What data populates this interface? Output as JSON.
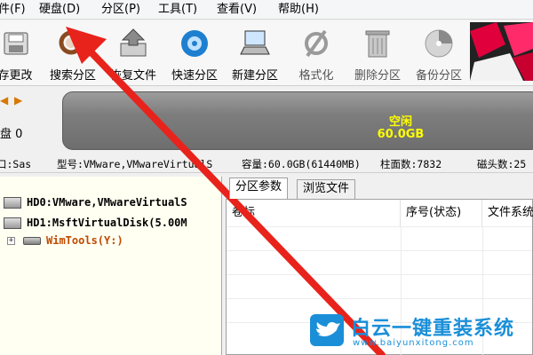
{
  "menu": {
    "items": [
      {
        "label": "件(F)"
      },
      {
        "label": "硬盘(D)"
      },
      {
        "label": "分区(P)"
      },
      {
        "label": "工具(T)"
      },
      {
        "label": "查看(V)"
      },
      {
        "label": "帮助(H)"
      }
    ]
  },
  "toolbar": {
    "items": [
      {
        "label": "存更改",
        "icon": "save-icon"
      },
      {
        "label": "搜索分区",
        "icon": "search-partition-icon"
      },
      {
        "label": "恢复文件",
        "icon": "recover-file-icon"
      },
      {
        "label": "快速分区",
        "icon": "quick-partition-icon"
      },
      {
        "label": "新建分区",
        "icon": "new-partition-icon"
      },
      {
        "label": "格式化",
        "icon": "format-icon"
      },
      {
        "label": "删除分区",
        "icon": "delete-partition-icon"
      },
      {
        "label": "备份分区",
        "icon": "backup-partition-icon"
      }
    ]
  },
  "disk": {
    "label": "盘 0",
    "free_label": "空闲",
    "free_size": "60.0GB",
    "bar_color": "#7d7d7d",
    "text_color": "#ffff00"
  },
  "info": {
    "interface": "口:Sas",
    "model": "型号:VMware,VMwareVirtualS",
    "capacity": "容量:60.0GB(61440MB)",
    "cylinders": "柱面数:7832",
    "heads": "磁头数:25"
  },
  "tree": {
    "items": [
      {
        "label": "HD0:VMware,VMwareVirtualS"
      },
      {
        "label": "HD1:MsftVirtualDisk(5.00M"
      },
      {
        "label": "WimTools(Y:)"
      }
    ]
  },
  "tabs": [
    {
      "label": "分区参数"
    },
    {
      "label": "浏览文件"
    }
  ],
  "table": {
    "columns": [
      {
        "label": "卷标"
      },
      {
        "label": "序号(状态)"
      },
      {
        "label": "文件系统"
      }
    ]
  },
  "watermark": {
    "title": "白云一键重装系统",
    "url": "www.baiyunxitong.com",
    "color": "#1a8fd8"
  },
  "annotation": {
    "arrow_color": "#e8231c"
  }
}
